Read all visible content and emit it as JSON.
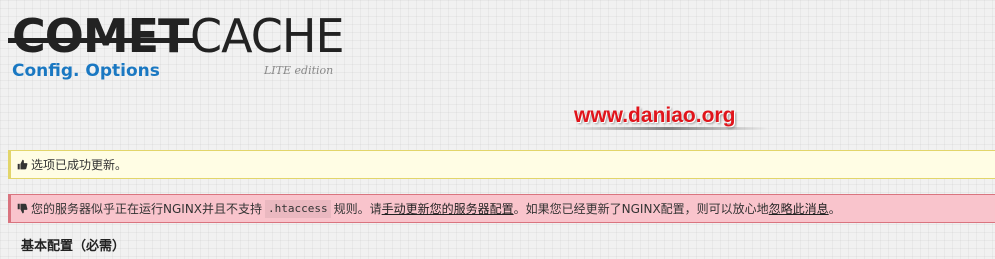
{
  "logo": {
    "comet": "COMET",
    "cache": "CACHE",
    "subtitle": "Config. Options",
    "edition": "LITE edition"
  },
  "watermark": {
    "text": "www.daniao.org"
  },
  "notices": {
    "success": {
      "icon": "thumbs-up-icon",
      "text": "选项已成功更新。"
    },
    "error": {
      "icon": "thumbs-down-icon",
      "text_before": "您的服务器似乎正在运行NGINX并且不支持",
      "code": ".htaccess",
      "text_mid": "规则。请",
      "link_update": "手动更新您的服务器配置",
      "text_after": "。如果您已经更新了NGINX配置，则可以放心地",
      "link_ignore": "忽略此消息",
      "text_end": "。"
    }
  },
  "section": {
    "title": "基本配置（必需）"
  },
  "colors": {
    "brand_blue": "#1a78c2",
    "watermark_red": "#e0141b",
    "success_bg": "#fffde4",
    "error_bg": "#f9c4cc"
  }
}
